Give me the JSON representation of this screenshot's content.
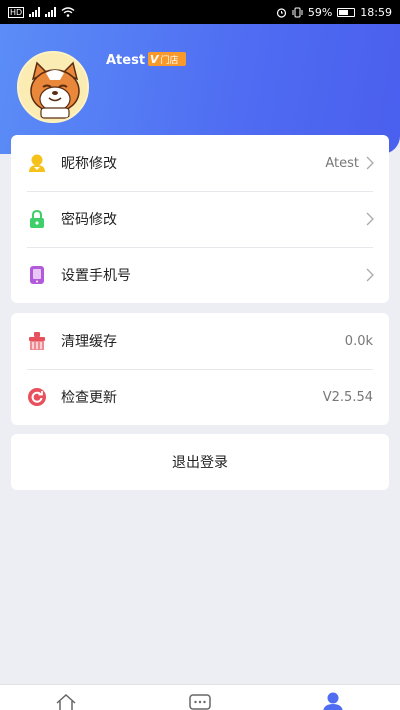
{
  "status_bar": {
    "battery": "59%",
    "time": "18:59",
    "carrier_left": "HD"
  },
  "profile": {
    "name": "Atest",
    "badge_mark": "V",
    "badge": "门店"
  },
  "settings_group_1": [
    {
      "label": "昵称修改",
      "value": "Atest",
      "icon": "user-icon",
      "color": "#f5c21b"
    },
    {
      "label": "密码修改",
      "value": "",
      "icon": "lock-icon",
      "color": "#3ecf6b"
    },
    {
      "label": "设置手机号",
      "value": "",
      "icon": "phone-icon",
      "color": "#b25ad9"
    }
  ],
  "settings_group_2": [
    {
      "label": "清理缓存",
      "value": "0.0k",
      "icon": "broom-icon",
      "color": "#e8505b"
    },
    {
      "label": "检查更新",
      "value": "V2.5.54",
      "icon": "update-icon",
      "color": "#e8505b"
    }
  ],
  "logout_label": "退出登录",
  "colors": {
    "header_gradient_start": "#5b8df7",
    "header_gradient_end": "#4a5fee",
    "badge": "#f79a2b",
    "active_tab": "#4f6cf2",
    "background": "#eceef4"
  },
  "tabbar": {
    "tabs": [
      {
        "icon": "home-icon",
        "active": false
      },
      {
        "icon": "message-icon",
        "active": false
      },
      {
        "icon": "profile-icon",
        "active": true
      }
    ]
  }
}
